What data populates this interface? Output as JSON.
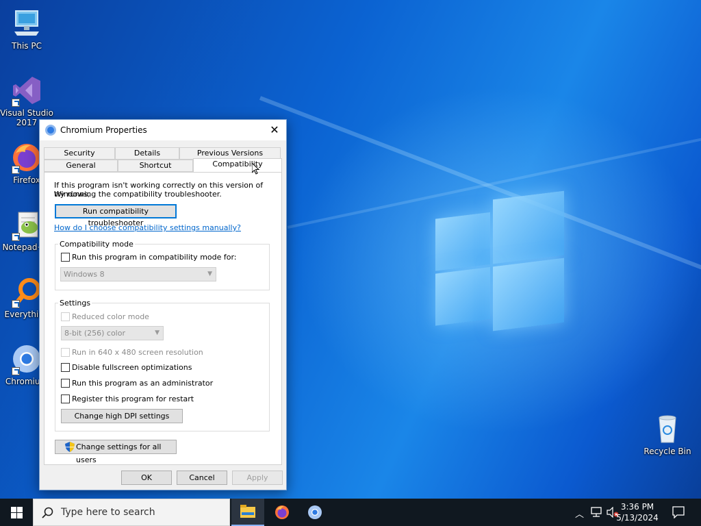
{
  "desktop": {
    "icons": [
      {
        "label": "This PC",
        "icon": "computer-icon"
      },
      {
        "label": "Visual Studio 2017",
        "icon": "visual-studio-icon"
      },
      {
        "label": "Firefox",
        "icon": "firefox-icon"
      },
      {
        "label": "Notepad++",
        "icon": "notepad-plus-plus-icon"
      },
      {
        "label": "Everything",
        "icon": "everything-search-icon"
      },
      {
        "label": "Chromium",
        "icon": "chromium-icon"
      },
      {
        "label": "Recycle Bin",
        "icon": "recycle-bin-icon"
      }
    ]
  },
  "dialog": {
    "title": "Chromium Properties",
    "close": "✕",
    "tabs_row1": [
      "Security",
      "Details",
      "Previous Versions"
    ],
    "tabs_row2": [
      "General",
      "Shortcut",
      "Compatibility"
    ],
    "active_tab": "Compatibility",
    "intro_line1": "If this program isn't working correctly on this version of Windows,",
    "intro_line2": "try running the compatibility troubleshooter.",
    "troubleshooter_button": "Run compatibility troubleshooter",
    "manual_link": "How do I choose compatibility settings manually?",
    "compat_mode": {
      "label": "Compatibility mode",
      "checkbox": "Run this program in compatibility mode for:",
      "selected_os": "Windows 8"
    },
    "settings": {
      "label": "Settings",
      "reduced_color": "Reduced color mode",
      "color_option": "8-bit (256) color",
      "run_640": "Run in 640 x 480 screen resolution",
      "disable_fullscreen": "Disable fullscreen optimizations",
      "run_admin": "Run this program as an administrator",
      "register_restart": "Register this program for restart",
      "dpi_button": "Change high DPI settings"
    },
    "all_users_button": "Change settings for all users",
    "ok": "OK",
    "cancel": "Cancel",
    "apply": "Apply"
  },
  "taskbar": {
    "search_placeholder": "Type here to search",
    "time": "3:36 PM",
    "date": "5/13/2024",
    "apps": [
      "file-explorer-icon",
      "firefox-icon",
      "chromium-icon"
    ]
  },
  "colors": {
    "accent": "#0078d7",
    "link": "#0066cc",
    "taskbar": "#101820"
  }
}
